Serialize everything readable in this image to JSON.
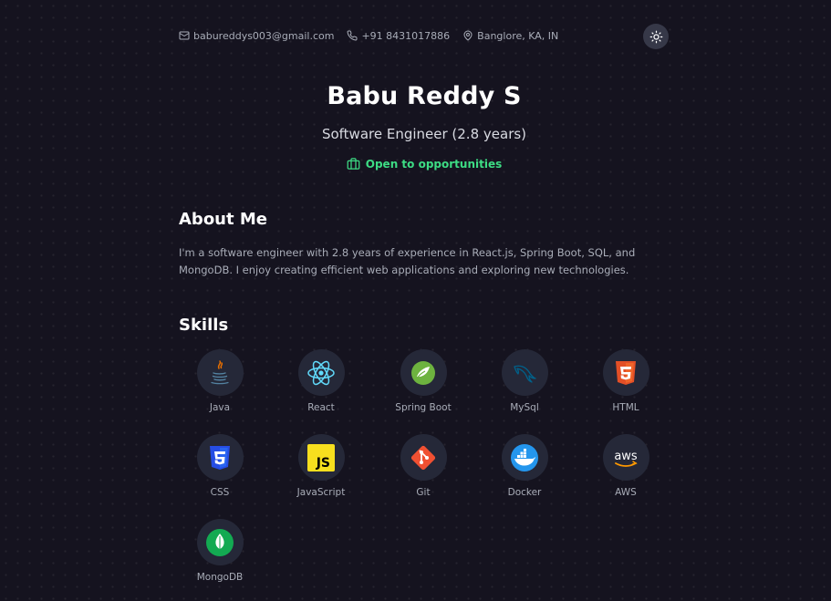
{
  "contact": {
    "email": "babureddys003@gmail.com",
    "phone": "+91 8431017886",
    "location": "Banglore, KA, IN"
  },
  "header": {
    "name": "Babu Reddy S",
    "role": "Software Engineer (2.8 years)",
    "status": "Open to opportunities"
  },
  "about": {
    "title": "About Me",
    "text": "I'm a software engineer with 2.8 years of experience in React.js, Spring Boot, SQL, and MongoDB. I enjoy creating efficient web applications and exploring new technologies."
  },
  "skills": {
    "title": "Skills",
    "items": [
      {
        "label": "Java",
        "icon": "java-icon"
      },
      {
        "label": "React",
        "icon": "react-icon"
      },
      {
        "label": "Spring Boot",
        "icon": "spring-boot-icon"
      },
      {
        "label": "MySql",
        "icon": "mysql-icon"
      },
      {
        "label": "HTML",
        "icon": "html5-icon"
      },
      {
        "label": "CSS",
        "icon": "css3-icon"
      },
      {
        "label": "JavaScript",
        "icon": "javascript-icon"
      },
      {
        "label": "Git",
        "icon": "git-icon"
      },
      {
        "label": "Docker",
        "icon": "docker-icon"
      },
      {
        "label": "AWS",
        "icon": "aws-icon"
      },
      {
        "label": "MongoDB",
        "icon": "mongodb-icon"
      }
    ]
  },
  "colors": {
    "background": "#15131f",
    "accent_green": "#3ddc84",
    "skill_circle": "#252838",
    "text_muted": "#a9adb8"
  }
}
